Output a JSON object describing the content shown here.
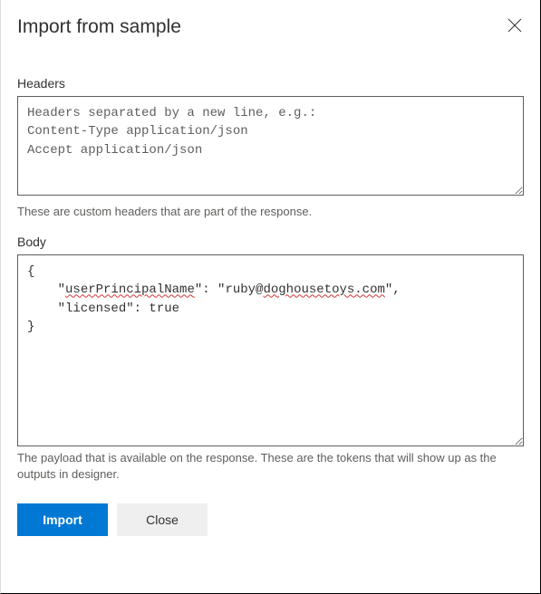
{
  "dialog": {
    "title": "Import from sample"
  },
  "headers": {
    "label": "Headers",
    "placeholder": "Headers separated by a new line, e.g.:\nContent-Type application/json\nAccept application/json",
    "value": "",
    "helper": "These are custom headers that are part of the response."
  },
  "body": {
    "label": "Body",
    "value": "{\n    \"userPrincipalName\": \"ruby@doghousetoys.com\",\n    \"licensed\": true\n}",
    "helper": "The payload that is available on the response. These are the tokens that will show up as the outputs in designer.",
    "tokens": [
      {
        "t": "{\n    \"",
        "err": false
      },
      {
        "t": "userPrincipalName",
        "err": true
      },
      {
        "t": "\": \"ruby@",
        "err": false
      },
      {
        "t": "doghousetoys.com",
        "err": true
      },
      {
        "t": "\",\n    \"licensed\": true\n}",
        "err": false
      }
    ]
  },
  "buttons": {
    "import": "Import",
    "close": "Close"
  }
}
